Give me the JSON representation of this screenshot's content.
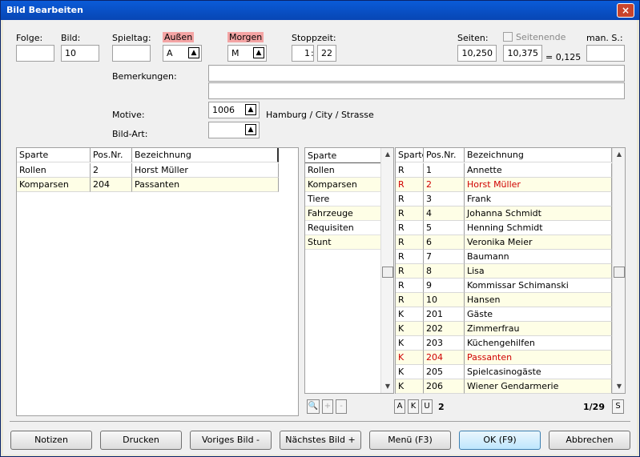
{
  "window": {
    "title": "Bild Bearbeiten",
    "close": "×"
  },
  "fields": {
    "folge_label": "Folge:",
    "folge_value": "",
    "bild_label": "Bild:",
    "bild_value": "10",
    "spieltag_label": "Spieltag:",
    "spieltag_value": "",
    "aussen_label": "Außen",
    "aussen_value": "A",
    "morgen_label": "Morgen",
    "morgen_value": "M",
    "stoppzeit_label": "Stoppzeit:",
    "stopp_min": "1",
    "stopp_sep": ":",
    "stopp_sec": "22",
    "seiten_label": "Seiten:",
    "seiten_from": "10,250",
    "seiten_to": "10,375",
    "seiten_diff": "= 0,125",
    "seitenende_label": "Seitenende",
    "mans_label": "man. S.:",
    "mans_value": "",
    "bemerkungen_label": "Bemerkungen:",
    "bemerkungen_1": "",
    "bemerkungen_2": "",
    "motive_label": "Motive:",
    "motive_value": "1006",
    "motive_text": "Hamburg / City / Strasse",
    "bildart_label": "Bild-Art:",
    "bildart_value": ""
  },
  "left_table": {
    "columns": [
      "Sparte",
      "Pos.Nr.",
      "Bezeichnung"
    ],
    "rows": [
      {
        "sparte": "Rollen",
        "pos": "2",
        "bez": "Horst Müller"
      },
      {
        "sparte": "Komparsen",
        "pos": "204",
        "bez": "Passanten"
      }
    ]
  },
  "categories": {
    "header": "Sparte",
    "items": [
      "Rollen",
      "Komparsen",
      "Tiere",
      "Fahrzeuge",
      "Requisiten",
      "Stunt"
    ]
  },
  "right_table": {
    "columns": [
      "Sparte",
      "Pos.Nr.",
      "Bezeichnung"
    ],
    "rows": [
      {
        "s": "R",
        "p": "1",
        "b": "Annette",
        "red": false
      },
      {
        "s": "R",
        "p": "2",
        "b": "Horst Müller",
        "red": true
      },
      {
        "s": "R",
        "p": "3",
        "b": "Frank",
        "red": false
      },
      {
        "s": "R",
        "p": "4",
        "b": "Johanna Schmidt",
        "red": false
      },
      {
        "s": "R",
        "p": "5",
        "b": "Henning Schmidt",
        "red": false
      },
      {
        "s": "R",
        "p": "6",
        "b": "Veronika Meier",
        "red": false
      },
      {
        "s": "R",
        "p": "7",
        "b": "Baumann",
        "red": false
      },
      {
        "s": "R",
        "p": "8",
        "b": "Lisa",
        "red": false
      },
      {
        "s": "R",
        "p": "9",
        "b": "Kommissar Schimanski",
        "red": false
      },
      {
        "s": "R",
        "p": "10",
        "b": "Hansen",
        "red": false
      },
      {
        "s": "K",
        "p": "201",
        "b": "Gäste",
        "red": false
      },
      {
        "s": "K",
        "p": "202",
        "b": "Zimmerfrau",
        "red": false
      },
      {
        "s": "K",
        "p": "203",
        "b": "Küchengehilfen",
        "red": false
      },
      {
        "s": "K",
        "p": "204",
        "b": "Passanten",
        "red": true
      },
      {
        "s": "K",
        "p": "205",
        "b": "Spielcasinogäste",
        "red": false
      },
      {
        "s": "K",
        "p": "206",
        "b": "Wiener Gendarmerie",
        "red": false
      }
    ]
  },
  "toolbar": {
    "btn_a": "A",
    "btn_k": "K",
    "btn_u": "U",
    "count": "2",
    "page": "1/29",
    "btn_s": "S",
    "plus": "+",
    "minus": "-"
  },
  "buttons": {
    "notizen": "Notizen",
    "drucken": "Drucken",
    "voriges": "Voriges Bild -",
    "naechstes": "Nächstes Bild +",
    "menu": "Menü (F3)",
    "ok": "OK (F9)",
    "abbrechen": "Abbrechen"
  },
  "colors": {
    "red_text": "#d00000",
    "label_highlight": "#f4a4a4",
    "row_alt": "#fefee6"
  }
}
